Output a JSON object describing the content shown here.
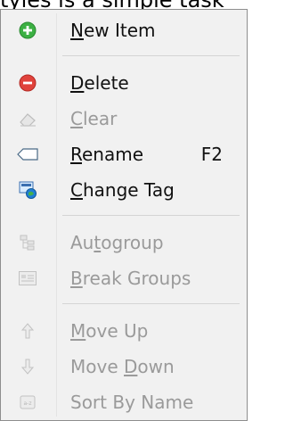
{
  "caption": {
    "text": "tyles is a simple task"
  },
  "menu": {
    "items": [
      {
        "label": "New Item",
        "mnemonic_index": 0,
        "shortcut": "",
        "enabled": true,
        "icon": "add-icon"
      },
      {
        "label": "Delete",
        "mnemonic_index": 0,
        "shortcut": "",
        "enabled": true,
        "icon": "delete-icon"
      },
      {
        "label": "Clear",
        "mnemonic_index": 0,
        "shortcut": "",
        "enabled": false,
        "icon": "eraser-icon"
      },
      {
        "label": "Rename",
        "mnemonic_index": 0,
        "shortcut": "F2",
        "enabled": true,
        "icon": "tag-icon"
      },
      {
        "label": "Change Tag",
        "mnemonic_index": 0,
        "shortcut": "",
        "enabled": true,
        "icon": "change-tag-icon"
      },
      {
        "label": "Autogroup",
        "mnemonic_index": 2,
        "shortcut": "",
        "enabled": false,
        "icon": "autogroup-icon"
      },
      {
        "label": "Break Groups",
        "mnemonic_index": 0,
        "shortcut": "",
        "enabled": false,
        "icon": "break-groups-icon"
      },
      {
        "label": "Move Up",
        "mnemonic_index": 0,
        "shortcut": "",
        "enabled": false,
        "icon": "arrow-up-icon"
      },
      {
        "label": "Move Down",
        "mnemonic_index": 5,
        "shortcut": "",
        "enabled": false,
        "icon": "arrow-down-icon"
      },
      {
        "label": "Sort By Name",
        "mnemonic_index": -1,
        "shortcut": "",
        "enabled": false,
        "icon": "sort-icon"
      }
    ]
  },
  "colors": {
    "menu_background": "#f1f1f1",
    "enabled_text": "#111111",
    "disabled_text": "#9a9a9a",
    "add_green": "#3cb043",
    "delete_red": "#e0433c"
  }
}
